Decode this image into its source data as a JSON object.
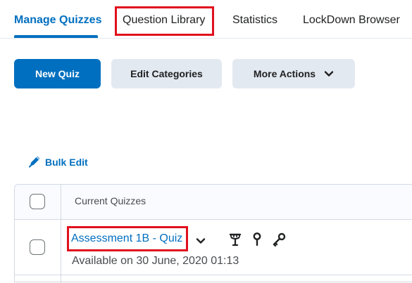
{
  "tabs": [
    {
      "label": "Manage Quizzes",
      "active": true
    },
    {
      "label": "Question Library",
      "active": false
    },
    {
      "label": "Statistics",
      "active": false
    },
    {
      "label": "LockDown Browser",
      "active": false
    }
  ],
  "toolbar": {
    "new_quiz_label": "New Quiz",
    "edit_categories_label": "Edit Categories",
    "more_actions_label": "More Actions"
  },
  "bulk_edit_label": "Bulk Edit",
  "table": {
    "header": "Current Quizzes",
    "rows": [
      {
        "title": "Assessment 1B - Quiz",
        "availability": "Available on 30 June, 2020 01:13"
      }
    ]
  },
  "icons": {
    "more_actions": "chevron-down-icon",
    "bulk_edit": "pencil-icon",
    "row_menu": "chevron-down-icon",
    "row_status": [
      "release-conditions-icon",
      "restrictions-pin-icon",
      "password-key-icon"
    ]
  },
  "colors": {
    "accent": "#006fbf",
    "highlight": "#e0101d",
    "secondary_button": "#e3e9f1"
  }
}
